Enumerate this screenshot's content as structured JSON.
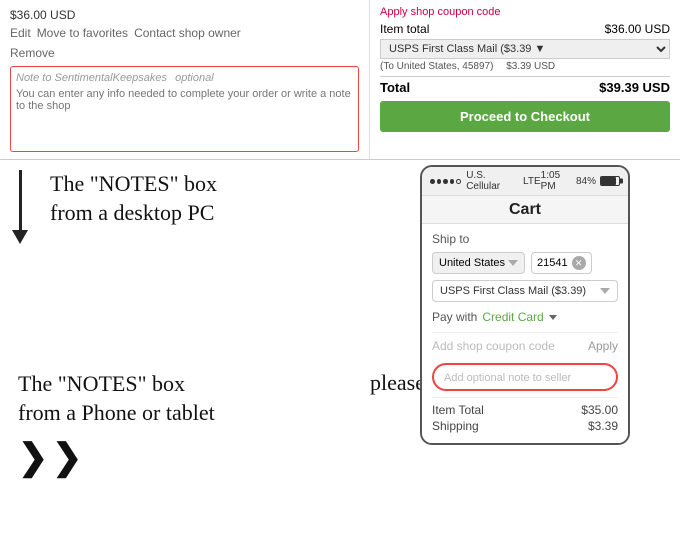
{
  "desktop": {
    "price": "$36.00 USD",
    "actions": {
      "edit": "Edit",
      "move_to_favorites": "Move to favorites",
      "contact_shop_owner": "Contact shop owner",
      "remove": "Remove"
    },
    "notes_label": "Note to SentimentalKeepsakes",
    "notes_optional": "optional",
    "notes_placeholder": "You can enter any info needed to complete your order or write a note to the shop",
    "cart": {
      "apply_coupon": "Apply shop coupon code",
      "item_total_label": "Item total",
      "item_total_value": "$36.00 USD",
      "shipping_label": "USPS First Class Mail ($3.39 ▼",
      "shipping_to": "To United States, 45897",
      "shipping_cost": "$3.39 USD",
      "total_label": "Total",
      "total_value": "$39.39 USD",
      "checkout_btn": "Proceed to Checkout"
    }
  },
  "annotations": {
    "desktop_label_line1": "The \"NOTES\" box",
    "desktop_label_line2": "from a desktop PC",
    "phone_label_line1": "The \"NOTES\" box",
    "phone_label_line2": "from a Phone or tablet",
    "bottom_text": "please leave us the"
  },
  "phone": {
    "status_bar": {
      "signal": "●●●●○",
      "carrier": "U.S. Cellular",
      "network": "LTE",
      "time": "1:05 PM",
      "battery": "84%"
    },
    "title": "Cart",
    "ship_to_label": "Ship to",
    "country": "United States",
    "zip": "21541",
    "shipping_method": "USPS First Class Mail ($3.39)",
    "pay_with_label": "Pay with",
    "pay_with_value": "Credit Card",
    "coupon_placeholder": "Add shop coupon code",
    "apply_label": "Apply",
    "note_seller_placeholder": "Add optional note to seller",
    "item_total_label": "Item Total",
    "item_total_value": "$35.00",
    "shipping_label": "Shipping",
    "shipping_value": "$3.39"
  }
}
